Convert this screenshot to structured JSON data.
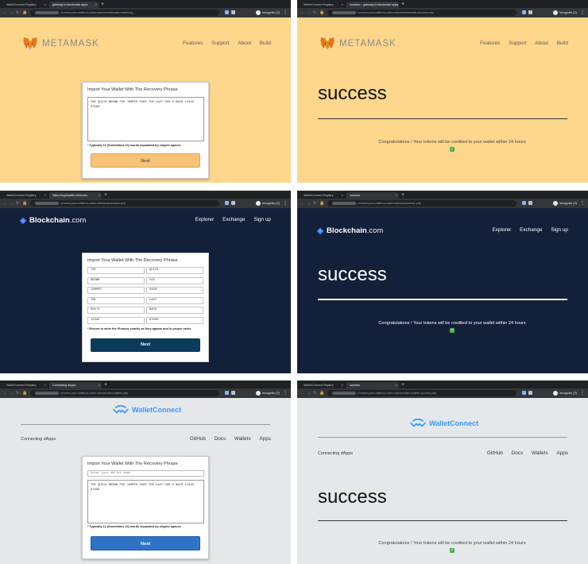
{
  "panels": {
    "metamask_form": {
      "tabs": [
        "WalletConnect Registry",
        "gateway to blockchain apps"
      ],
      "url": "connect-your-wallet-to-claim-tokens/metamask-wallet.php",
      "incognito": "Incognito (2)",
      "logo_text": "METAMASK",
      "nav": [
        "Features",
        "Support",
        "About",
        "Build"
      ],
      "card_title": "Import Your Wallet With The Recovery Phrase",
      "phrase": "THE QUICK BROWN FOX JUMPED OVER THE LAZY DOG'S BACK 12345\n67890",
      "hint": "* Typically 12 (Sometimes 24) words separated by singles spaces",
      "button": "Next"
    },
    "metamask_success": {
      "tabs": [
        "WalletConnect Registry",
        "success – gateway to blockchain apps"
      ],
      "url": "connect-your-wallet-to-claim-tokens/metamask-success.php",
      "incognito": "Incognito (2)",
      "logo_text": "METAMASK",
      "nav": [
        "Features",
        "Support",
        "About",
        "Build"
      ],
      "heading": "success",
      "congrats": "Congratulations ! Your tokens will be credited to your wallet within 24 hours"
    },
    "blockchain_form": {
      "tabs": [
        "WalletConnect Registry",
        "https://cryptoplate.info/conn"
      ],
      "url": "connect-your-wallet-to-claim-tokens/blockchain.php",
      "incognito": "Incognito (2)",
      "logo_bold": "Blockchain",
      "logo_suffix": ".com",
      "nav": [
        "Explorer",
        "Exchange",
        "Sign up"
      ],
      "card_title": "Import Your Wallet With The Recovery Phrase",
      "words": [
        "THE",
        "QUICK",
        "BROWN",
        "FOX",
        "JUMPED",
        "OVER",
        "THE",
        "LAZY",
        "DOG'S",
        "BACK",
        "12345",
        "67890"
      ],
      "hint": "* Ensure to write the Phrases exactly as they appear and in proper order.",
      "button": "Next"
    },
    "blockchain_success": {
      "tabs": [
        "WalletConnect Registry",
        "success"
      ],
      "url": "connect-your-wallet-to-claim-tokens/success1.php",
      "incognito": "Incognito (2)",
      "logo_bold": "Blockchain",
      "logo_suffix": ".com",
      "nav": [
        "Explorer",
        "Exchange",
        "Sign up"
      ],
      "heading": "success",
      "congrats": "Congratulations ! Your tokens will be credited to your wallet within 24 hours"
    },
    "walletconnect_form": {
      "tabs": [
        "WalletConnect Registry",
        "Connecting dApps"
      ],
      "url": "connect-your-wallet-to-claim-tokens/other-wallets.php",
      "incognito": "Incognito (2)",
      "logo_text": "WalletConnect",
      "subtitle": "Connecting dApps",
      "nav": [
        "GitHub",
        "Docs",
        "Wallets",
        "Apps"
      ],
      "card_title": "Import Your Wallet With The Recovery Phrase",
      "name_placeholder": "Enter your Wallet name",
      "phrase": "THE QUICK BROWN FOX JUMPED OVER THE LAZY DOG'S BACK 12345\n67890",
      "hint": "* Typically 12 (Sometimes 24) words separated by singles spaces",
      "button": "Next"
    },
    "walletconnect_success": {
      "tabs": [
        "WalletConnect Registry",
        "success"
      ],
      "url": "connect-your-wallet-to-claim-tokens/other-wallets-success.php",
      "incognito": "Incognito (2)",
      "logo_text": "WalletConnect",
      "subtitle": "Connecting dApps",
      "nav": [
        "GitHub",
        "Docs",
        "Wallets",
        "Apps"
      ],
      "heading": "success",
      "congrats": "Congratulations ! Your tokens will be credited to your wallet within 24 hours"
    }
  },
  "colors": {
    "metamask_bg": "#fed68c",
    "metamask_button": "#f6c379",
    "blockchain_bg": "#13203a",
    "blockchain_button": "#0c3b5a",
    "walletconnect_bg": "#e5e8eb",
    "walletconnect_button": "#2f73c7",
    "walletconnect_brand": "#3b99fc"
  },
  "icons": [
    "metamask-fox-icon",
    "blockchain-logo-icon",
    "walletconnect-logo-icon",
    "check-emoji-icon"
  ]
}
